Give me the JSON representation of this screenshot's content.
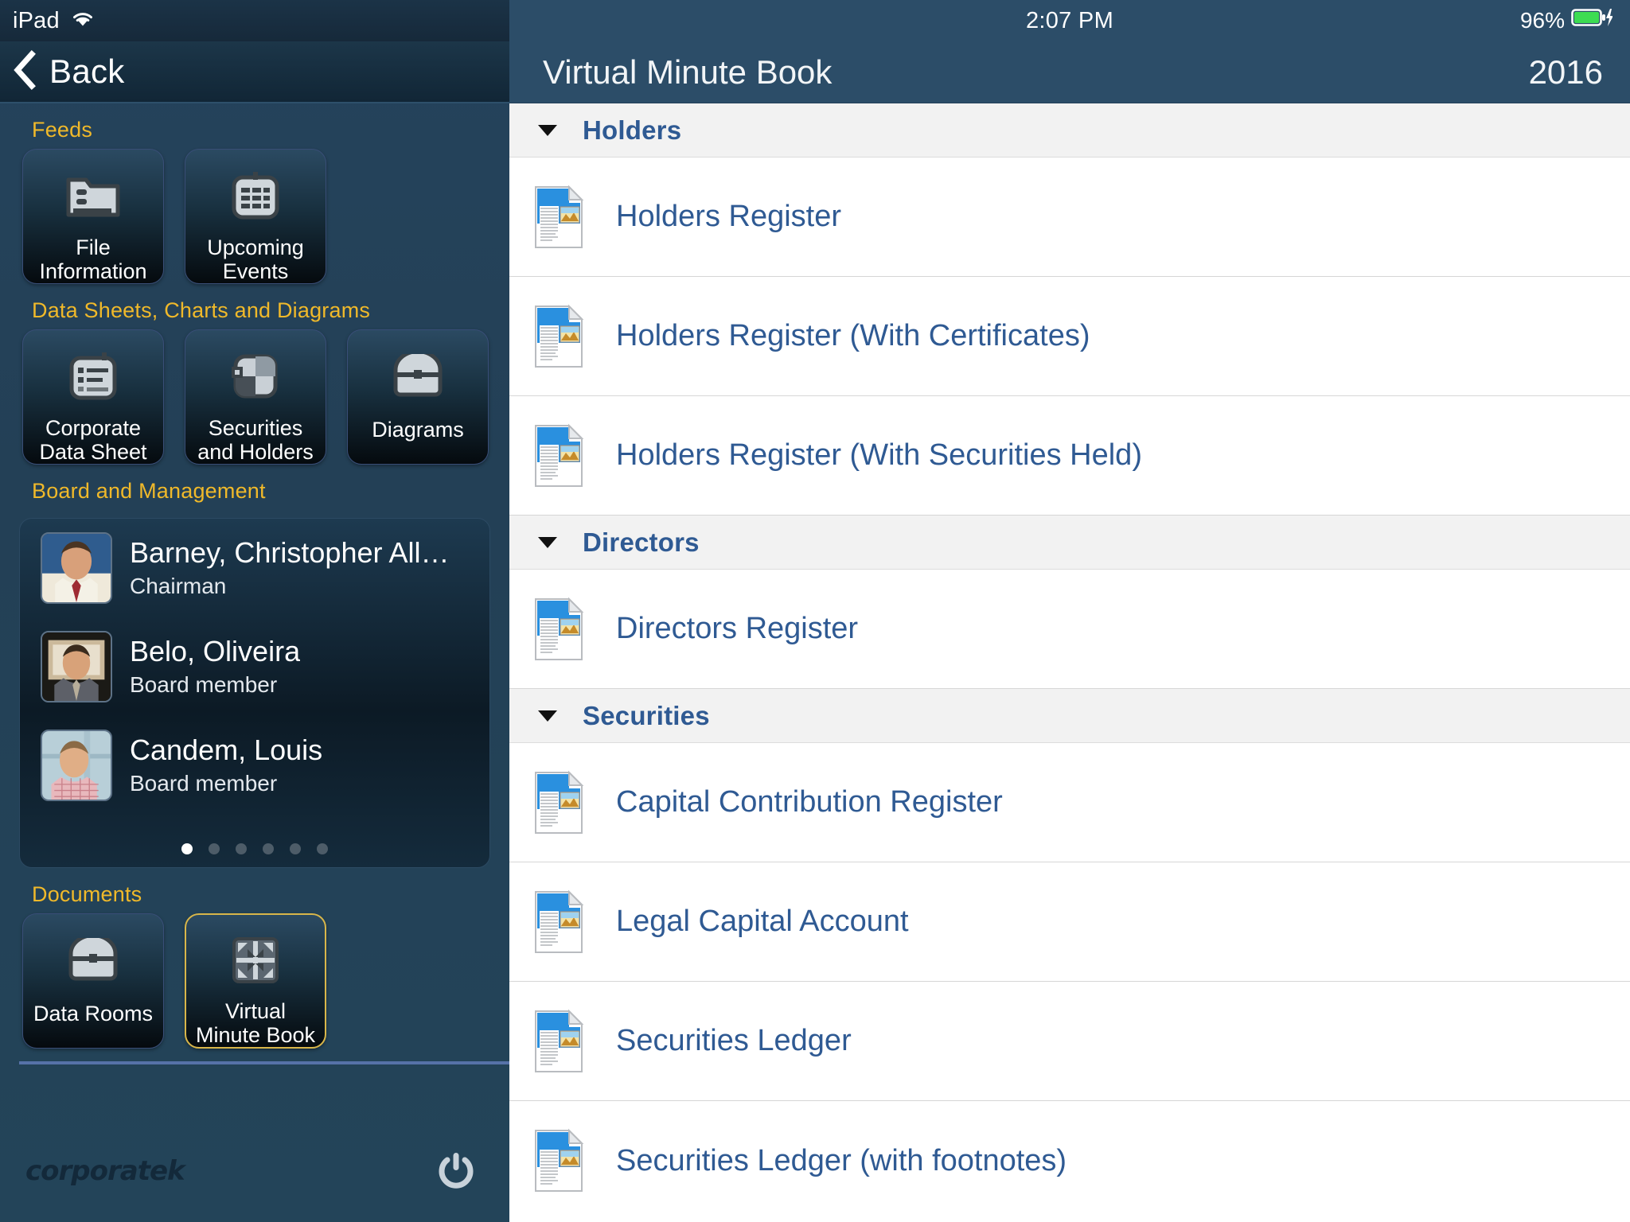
{
  "status_bar": {
    "device_label": "iPad",
    "wifi_icon": "wifi-icon",
    "time": "2:07 PM",
    "battery_percent": "96%",
    "battery_icon": "battery-charging-icon"
  },
  "sidebar": {
    "back_button": {
      "label": "Back",
      "icon": "chevron-left-icon"
    },
    "sections": [
      {
        "title": "Feeds",
        "tiles": [
          {
            "label": "File Information",
            "icon": "file-information-icon",
            "selected": false
          },
          {
            "label": "Upcoming Events",
            "icon": "calendar-icon",
            "selected": false
          }
        ]
      },
      {
        "title": "Data Sheets, Charts and Diagrams",
        "tiles": [
          {
            "label": "Corporate Data Sheet",
            "icon": "clipboard-list-icon",
            "selected": false
          },
          {
            "label": "Securities and Holders",
            "icon": "pie-quadrant-icon",
            "selected": false
          },
          {
            "label": "Diagrams",
            "icon": "briefcase-icon",
            "selected": false
          }
        ]
      },
      {
        "title": "Board and Management",
        "people": [
          {
            "name": "Barney, Christopher All…",
            "role": "Chairman",
            "avatar": "avatar-photo"
          },
          {
            "name": "Belo, Oliveira",
            "role": "Board member",
            "avatar": "avatar-photo"
          },
          {
            "name": "Candem, Louis",
            "role": "Board member",
            "avatar": "avatar-photo"
          }
        ],
        "pager": {
          "count": 6,
          "active_index": 0
        }
      },
      {
        "title": "Documents",
        "tiles": [
          {
            "label": "Data Rooms",
            "icon": "briefcase-icon",
            "selected": false
          },
          {
            "label": "Virtual Minute Book",
            "icon": "minute-book-icon",
            "selected": true
          }
        ]
      }
    ],
    "footer": {
      "brand": "corporatek",
      "power_button_icon": "power-icon"
    }
  },
  "main": {
    "title": "Virtual Minute Book",
    "year": "2016",
    "groups": [
      {
        "title": "Holders",
        "expanded": true,
        "disclosure_icon": "triangle-down-icon",
        "documents": [
          {
            "label": "Holders Register",
            "icon": "document-icon"
          },
          {
            "label": "Holders Register (With Certificates)",
            "icon": "document-icon"
          },
          {
            "label": "Holders Register (With Securities Held)",
            "icon": "document-icon"
          }
        ]
      },
      {
        "title": "Directors",
        "expanded": true,
        "disclosure_icon": "triangle-down-icon",
        "documents": [
          {
            "label": "Directors Register",
            "icon": "document-icon"
          }
        ]
      },
      {
        "title": "Securities",
        "expanded": true,
        "disclosure_icon": "triangle-down-icon",
        "documents": [
          {
            "label": "Capital Contribution Register",
            "icon": "document-icon"
          },
          {
            "label": "Legal Capital Account",
            "icon": "document-icon"
          },
          {
            "label": "Securities Ledger",
            "icon": "document-icon"
          },
          {
            "label": "Securities Ledger (with footnotes)",
            "icon": "document-icon"
          }
        ]
      }
    ]
  },
  "colors": {
    "sidebar_bg": "#234358",
    "navbar_bg": "#2c4d68",
    "section_title": "#f0b92a",
    "link_blue": "#2f5a93",
    "group_header_bg": "#f2f2f2",
    "selected_tile_border": "#d8b64a",
    "battery_green": "#3ddc52"
  }
}
